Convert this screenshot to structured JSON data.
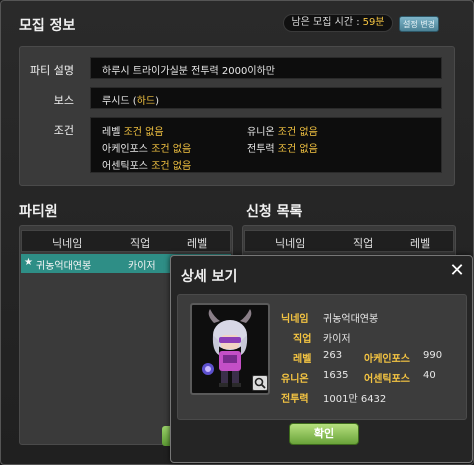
{
  "window": {
    "title": "모집 정보",
    "timer_label": "남은 모집 시간 :",
    "timer_value": "59분",
    "setting_button": "설정 변경"
  },
  "info": {
    "desc_label": "파티 설명",
    "desc_value": "하루시 트라이가실분 전투력 2000이하만",
    "boss_label": "보스",
    "boss_value_prefix": "루시드 (",
    "boss_value_mode": "하드",
    "boss_value_suffix": ")",
    "cond_label": "조건",
    "conditions": [
      {
        "name": "레벨",
        "value": "조건 없음"
      },
      {
        "name": "유니온",
        "value": "조건 없음"
      },
      {
        "name": "아케인포스",
        "value": "조건 없음"
      },
      {
        "name": "전투력",
        "value": "조건 없음"
      },
      {
        "name": "어센틱포스",
        "value": "조건 없음"
      }
    ]
  },
  "party": {
    "title": "파티원",
    "headers": [
      "닉네임",
      "직업",
      "레벨"
    ],
    "members": [
      {
        "name": "귀농억대연봉",
        "job": "카이저"
      }
    ]
  },
  "applicants": {
    "title": "신청 목록",
    "headers": [
      "닉네임",
      "직업",
      "레벨"
    ]
  },
  "detail": {
    "title": "상세 보기",
    "nickname_label": "닉네임",
    "nickname": "귀농억대연봉",
    "job_label": "직업",
    "job": "카이저",
    "level_label": "레벨",
    "level": "263",
    "arcane_label": "아케인포스",
    "arcane": "990",
    "union_label": "유니온",
    "union": "1635",
    "authentic_label": "어센틱포스",
    "authentic": "40",
    "power_label": "전투력",
    "power": "1001만 6432",
    "confirm_button": "확인"
  },
  "colors": {
    "accent_yellow": "#f5c542",
    "selected_row": "#2e8e86",
    "confirm_green": "#6aa33a"
  }
}
